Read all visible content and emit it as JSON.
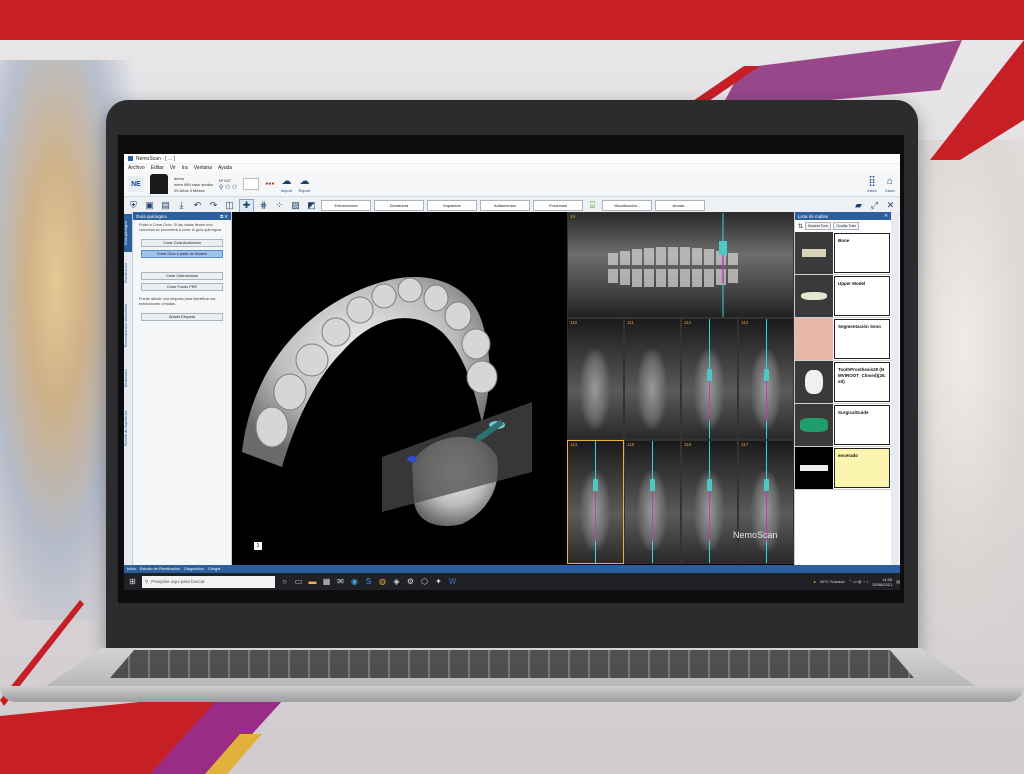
{
  "window": {
    "title": "NemoScan - [ ... ] ",
    "app_icon": "app-icon"
  },
  "menu": [
    "Archivo",
    "Editar",
    "Vir",
    "Ira",
    "Ventana",
    "Ayuda"
  ],
  "ribbon": {
    "badge": "NE",
    "patient_name": "demo",
    "patient_line2": "mem 989 caso similar",
    "patient_age": "29 Años 3 Meses",
    "patient_id": "Nº 637",
    "import_label": "Import",
    "export_label": "Export",
    "home_label": "Inicio",
    "exit_label": "Inicio"
  },
  "workflow_buttons": [
    "Extracciones",
    "Dentadura",
    "Implantes",
    "Aditamentos",
    "Productos",
    "Visualización...",
    "Anotar..."
  ],
  "left_panel": {
    "title": "Guía quirúrgica",
    "intro": "Pulse a Crear Guía. Si las vistas tienen una correctas se procederá a crear la guía quirúrgica.",
    "buttons": [
      {
        "label": "Crear Guía Anatómica",
        "primary": false
      },
      {
        "label": "Crear Guía a partir de Modelo",
        "primary": true
      },
      {
        "label": "Crear Osteotomías",
        "primary": false
      },
      {
        "label": "Crear Fundo PRE",
        "primary": false
      }
    ],
    "note": "Puede añadir una etiqueta para identificar las extracciones creadas.",
    "label_button": "Añadir Etiqueta",
    "vtabs": [
      "Guía quirúrgica",
      "Planificación",
      "Reconstrucción Volumétrica",
      "Mediciones",
      "Recorte de Superficies"
    ]
  },
  "viewer": {
    "panoramic_num": "19",
    "slices": [
      "110",
      "111",
      "112",
      "113",
      "114",
      "115",
      "116",
      "117"
    ],
    "watermark": "NemoScan",
    "corner_badge": "1"
  },
  "right_panel": {
    "title": "Lista de mallas",
    "show_all": "Mostrar Todo",
    "hide_all": "Ocultar Todo",
    "meshes": [
      {
        "label": "Bone",
        "selected": false
      },
      {
        "label": "Upper Model",
        "selected": false
      },
      {
        "label": "Segmentación Seno",
        "selected": false
      },
      {
        "label": "ToothProsthesis29 (NMVIROOT_Closed)(26.stl)",
        "selected": false
      },
      {
        "label": "SurgicalGuide",
        "selected": false
      },
      {
        "label": "encerado",
        "selected": true
      }
    ]
  },
  "bottom_tabs": [
    "Inicio",
    "Estudio de Planificación",
    "Diagnóstico",
    "Cirugía"
  ],
  "taskbar": {
    "search_placeholder": "Pesquise aqui para buscar",
    "weather": "26°C  Soleado",
    "time": "14:06",
    "date": "25/06/2021"
  },
  "colors": {
    "accent": "#2c5f9e",
    "brand_red": "#c62026",
    "implant": "#2fd7d7",
    "purple": "#c03ab8"
  }
}
